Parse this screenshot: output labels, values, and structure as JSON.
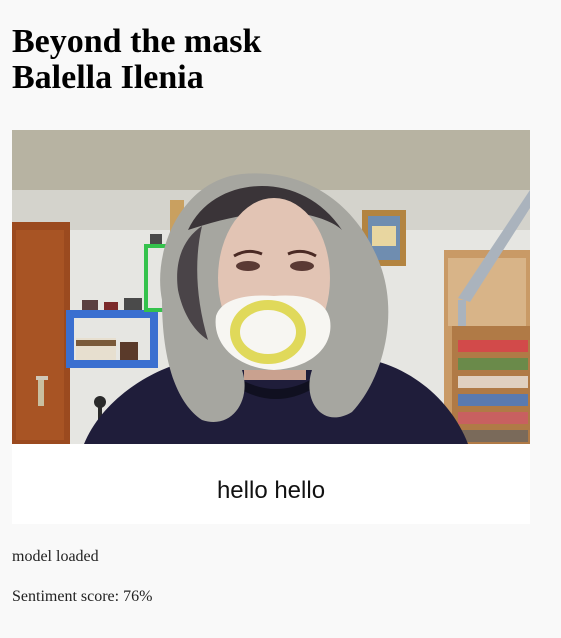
{
  "header": {
    "title_line1": "Beyond the mask",
    "title_line2": "Balella Ilenia"
  },
  "webcam": {
    "icon": "webcam-feed",
    "mask_overlay_color": "#e0d95a"
  },
  "caption": {
    "text": "hello hello"
  },
  "status": {
    "model_text": "model loaded",
    "sentiment_label": "Sentiment score:",
    "sentiment_value": "76%",
    "sentiment_text": "Sentiment score: 76%"
  }
}
